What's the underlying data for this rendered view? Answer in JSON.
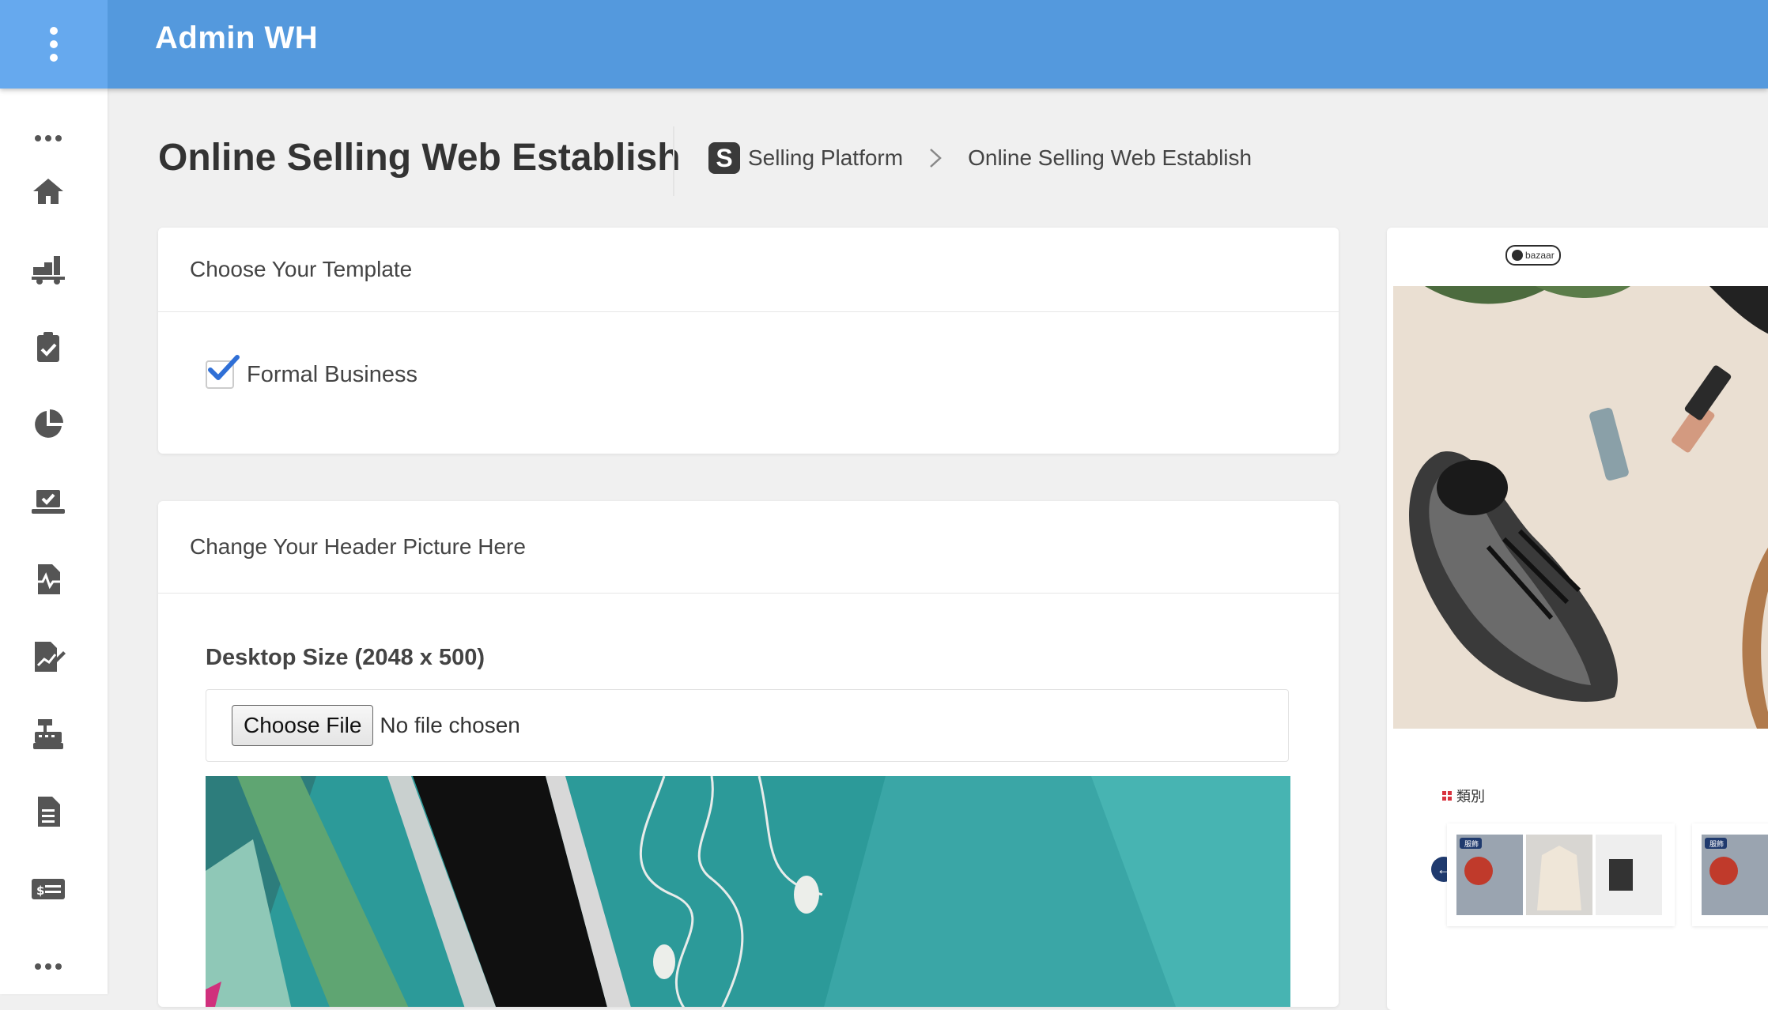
{
  "app": {
    "title": "Admin WH"
  },
  "page": {
    "title": "Online Selling Web Establish"
  },
  "breadcrumb": {
    "logo_letter": "S",
    "items": [
      "Selling Platform",
      "Online Selling Web Establish"
    ]
  },
  "sidebar": {
    "icons": [
      "more-dots-icon",
      "home-icon",
      "delivery-truck-icon",
      "clipboard-check-icon",
      "pie-chart-icon",
      "laptop-check-icon",
      "file-activity-icon",
      "signature-chart-icon",
      "cash-register-icon",
      "document-icon",
      "money-card-icon",
      "more-dots-icon"
    ]
  },
  "template_card": {
    "heading": "Choose Your Template",
    "option_label": "Formal Business",
    "option_checked": true
  },
  "header_card": {
    "heading": "Change Your Header Picture Here",
    "desktop_label": "Desktop Size (2048 x 500)",
    "choose_file_label": "Choose File",
    "file_status": "No file chosen"
  },
  "preview": {
    "logo_text": "bazaar",
    "category_label": "類別",
    "badge_text": "服飾"
  },
  "colors": {
    "topbar": "#5499dd",
    "menu_square": "#66a9ee",
    "checkmark": "#2f6fd6"
  }
}
